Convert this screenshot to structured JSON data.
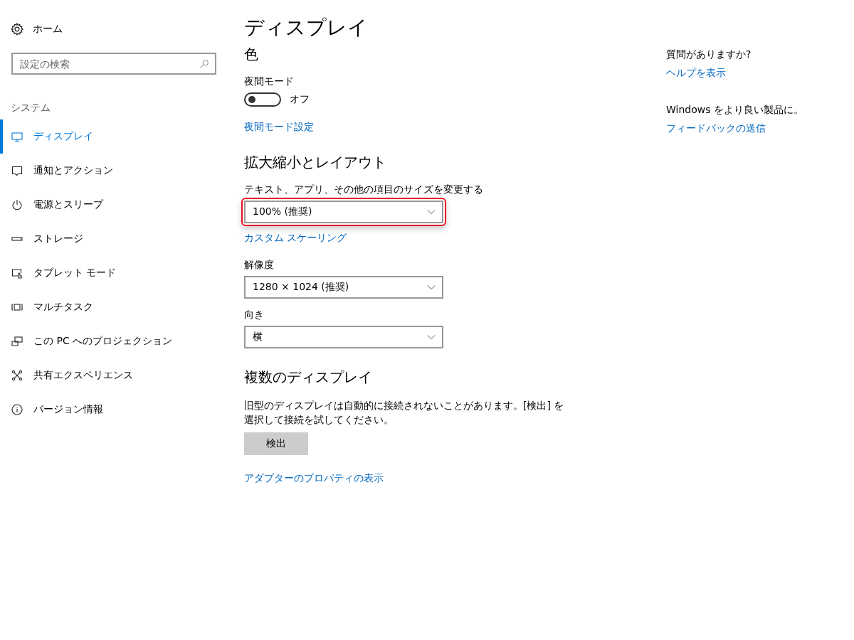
{
  "sidebar": {
    "home": "ホーム",
    "search": {
      "placeholder": "設定の検索"
    },
    "section": "システム",
    "items": [
      {
        "label": "ディスプレイ",
        "selected": true
      },
      {
        "label": "通知とアクション",
        "selected": false
      },
      {
        "label": "電源とスリープ",
        "selected": false
      },
      {
        "label": "ストレージ",
        "selected": false
      },
      {
        "label": "タブレット モード",
        "selected": false
      },
      {
        "label": "マルチタスク",
        "selected": false
      },
      {
        "label": "この PC へのプロジェクション",
        "selected": false
      },
      {
        "label": "共有エクスペリエンス",
        "selected": false
      },
      {
        "label": "バージョン情報",
        "selected": false
      }
    ]
  },
  "page_title": "ディスプレイ",
  "sections": [
    {
      "heading": "色",
      "controls": [
        {
          "kind": "toggle",
          "label": "夜間モード",
          "on": false,
          "state_text": "オフ"
        },
        {
          "kind": "link",
          "text": "夜間モード設定"
        }
      ]
    },
    {
      "heading": "拡大縮小とレイアウト",
      "controls": [
        {
          "kind": "dropdown",
          "label": "テキスト、アプリ、その他の項目のサイズを変更する",
          "value": "100% (推奨)",
          "highlighted": true
        },
        {
          "kind": "link",
          "text": "カスタム スケーリング"
        },
        {
          "kind": "dropdown",
          "label": "解像度",
          "value": "1280 × 1024 (推奨)",
          "highlighted": false
        },
        {
          "kind": "dropdown",
          "label": "向き",
          "value": "横",
          "highlighted": false
        }
      ]
    },
    {
      "heading": "複数のディスプレイ",
      "controls": [
        {
          "kind": "text",
          "text": "旧型のディスプレイは自動的に接続されないことがあります。[検出] を選択して接続を試してください。"
        },
        {
          "kind": "button",
          "text": "検出"
        },
        {
          "kind": "link",
          "text": "アダプターのプロパティの表示"
        }
      ]
    }
  ],
  "aside": [
    {
      "heading": "質問がありますか?",
      "link": "ヘルプを表示"
    },
    {
      "heading": "Windows をより良い製品に。",
      "link": "フィードバックの送信"
    }
  ]
}
